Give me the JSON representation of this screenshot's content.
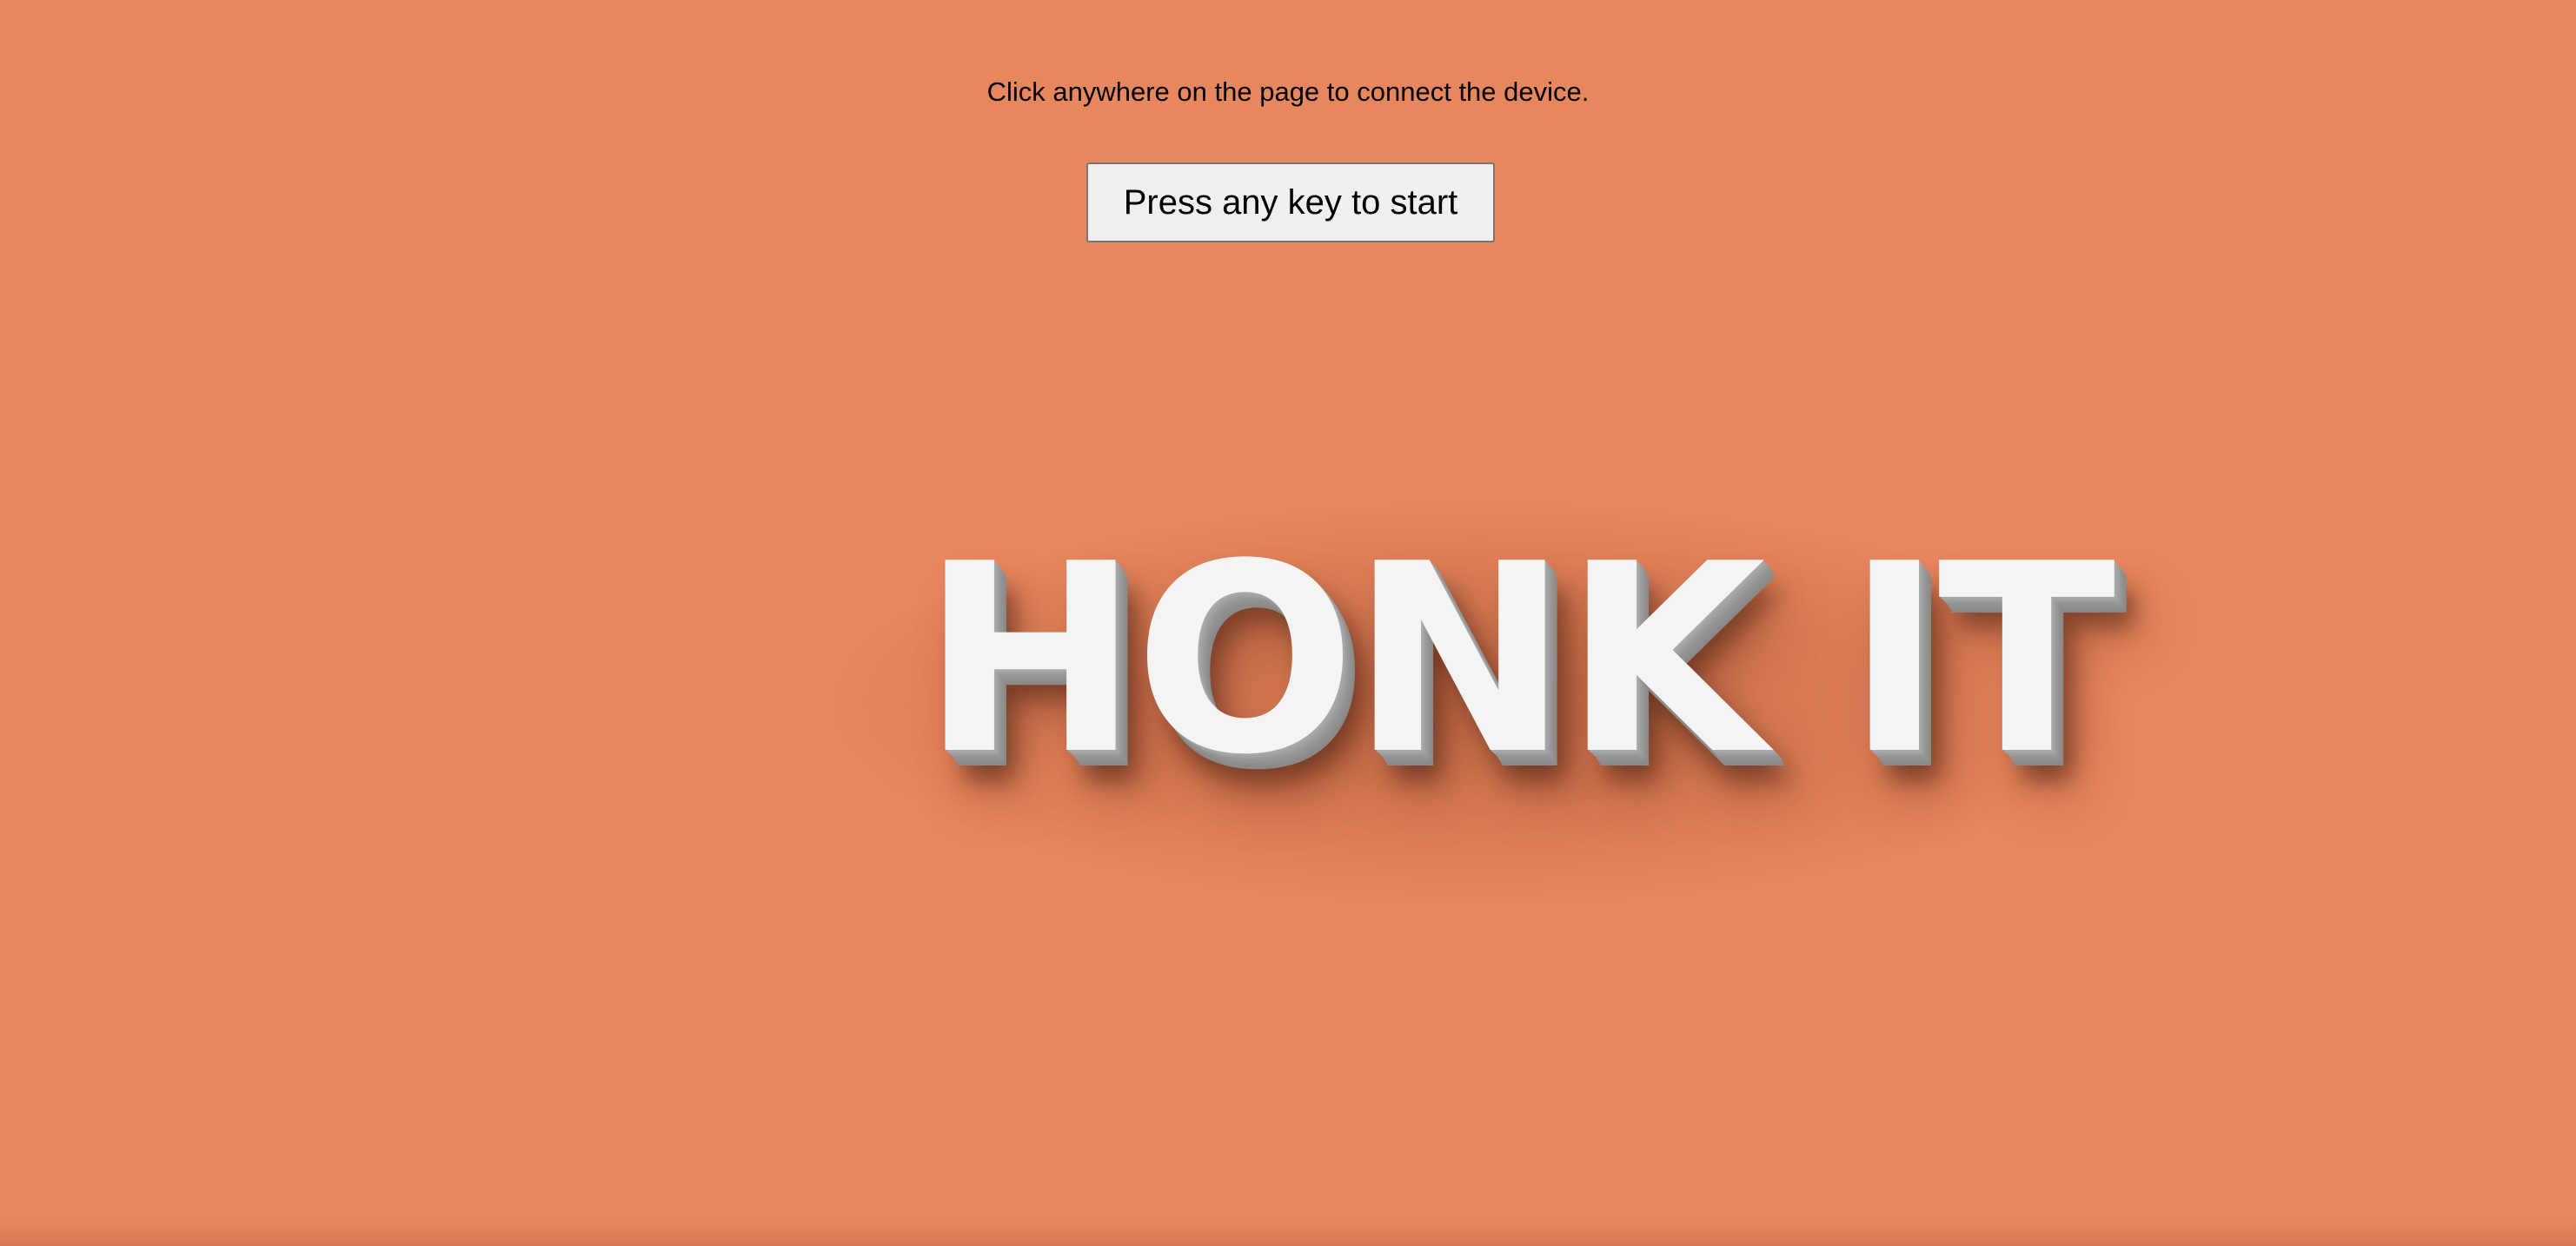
{
  "instruction": {
    "text": "Click anywhere on the page to connect the device."
  },
  "start_button": {
    "label": "Press any key to start"
  },
  "title": {
    "text": "HONK IT"
  },
  "colors": {
    "background": "#e8865e",
    "button_background": "#efefef",
    "button_border": "#767676",
    "title_text": "#f4f4f4",
    "title_extrusion": "#8e8e8e"
  }
}
